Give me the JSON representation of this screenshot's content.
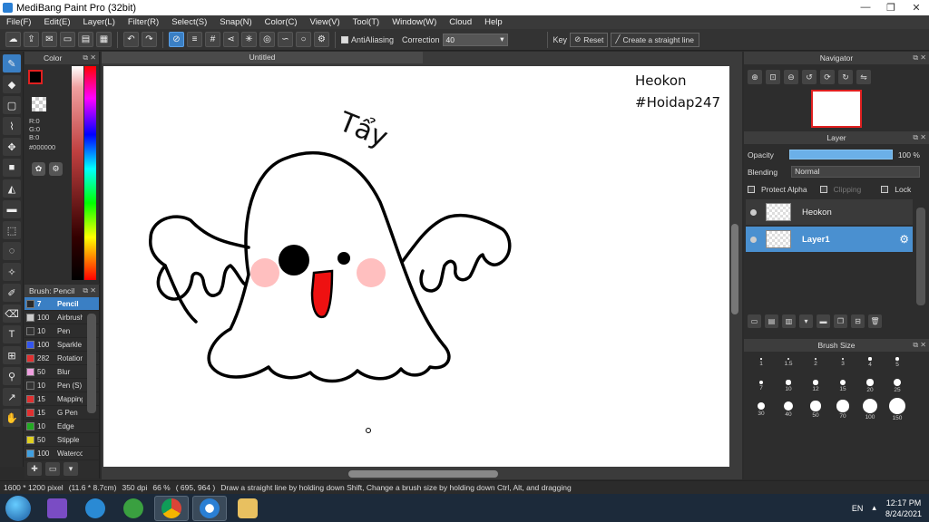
{
  "window": {
    "title": "MediBang Paint Pro (32bit)",
    "minimize": "—",
    "maximize": "❐",
    "close": "✕"
  },
  "menu": [
    "File(F)",
    "Edit(E)",
    "Layer(L)",
    "Filter(R)",
    "Select(S)",
    "Snap(N)",
    "Color(C)",
    "View(V)",
    "Tool(T)",
    "Window(W)",
    "Cloud",
    "Help"
  ],
  "toolbar": {
    "antialiasing_label": "AntiAliasing",
    "correction_label": "Correction",
    "correction_value": "40",
    "key_label": "Key",
    "reset_label": "Reset",
    "straight_line_label": "Create a straight line"
  },
  "color_panel": {
    "title": "Color",
    "r": "R:0",
    "g": "G:0",
    "b": "B:0",
    "hex": "#000000",
    "foreground": "#000000"
  },
  "brush_panel": {
    "title": "Brush: Pencil",
    "items": [
      {
        "size": "7",
        "name": "Pencil",
        "color": "#2a2a2a"
      },
      {
        "size": "100",
        "name": "Airbrush",
        "color": "#cccccc"
      },
      {
        "size": "10",
        "name": "Pen",
        "color": "#333333"
      },
      {
        "size": "100",
        "name": "Sparkle",
        "color": "#3355ee"
      },
      {
        "size": "282",
        "name": "Rotation",
        "color": "#e03030"
      },
      {
        "size": "50",
        "name": "Blur",
        "color": "#f0a0e0"
      },
      {
        "size": "10",
        "name": "Pen (S)",
        "color": "#333333"
      },
      {
        "size": "15",
        "name": "Mapping",
        "color": "#e03030"
      },
      {
        "size": "15",
        "name": "G Pen",
        "color": "#e03030"
      },
      {
        "size": "10",
        "name": "Edge",
        "color": "#22aa22"
      },
      {
        "size": "50",
        "name": "Stipple",
        "color": "#e0d020"
      },
      {
        "size": "100",
        "name": "Watercolor",
        "color": "#40a0e0"
      }
    ]
  },
  "document": {
    "tab": "Untitled",
    "signature_line1": "Heokon",
    "signature_line2": "#Hoidap247",
    "handwriting": "Tẩy"
  },
  "navigator": {
    "title": "Navigator"
  },
  "layer_panel": {
    "title": "Layer",
    "opacity_label": "Opacity",
    "opacity_value": "100 %",
    "opacity_fraction": 1.0,
    "blending_label": "Blending",
    "blending_value": "Normal",
    "protect_alpha": "Protect Alpha",
    "clipping": "Clipping",
    "lock": "Lock",
    "layers": [
      {
        "name": "Heokon",
        "selected": false
      },
      {
        "name": "Layer1",
        "selected": true
      }
    ]
  },
  "brush_size": {
    "title": "Brush Size",
    "sizes": [
      "1",
      "1.5",
      "2",
      "3",
      "4",
      "5",
      "7",
      "10",
      "12",
      "15",
      "20",
      "25",
      "30",
      "40",
      "50",
      "70",
      "100",
      "150"
    ]
  },
  "status": {
    "pixels": "1600 * 1200 pixel",
    "cm": "(11.6 * 8.7cm)",
    "dpi": "350 dpi",
    "zoom": "66 %",
    "coords": "( 695, 964 )",
    "hint": "Draw a straight line by holding down Shift, Change a brush size by holding down Ctrl, Alt, and dragging"
  },
  "taskbar": {
    "language": "EN",
    "time": "12:17 PM",
    "date": "8/24/2021"
  },
  "accent_color": "#3a7fc4"
}
